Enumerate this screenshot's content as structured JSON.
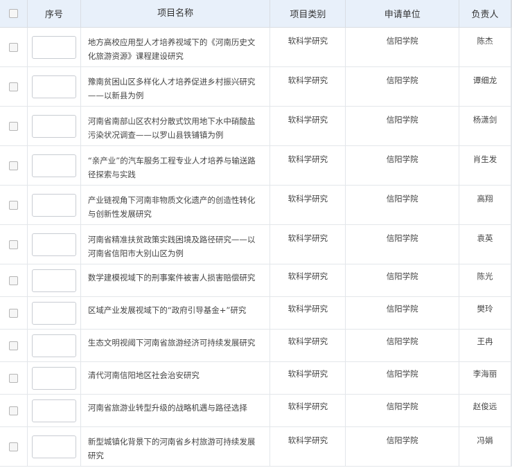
{
  "headers": {
    "seq": "序号",
    "name": "项目名称",
    "category": "项目类别",
    "unit": "申请单位",
    "leader": "负责人"
  },
  "rows": [
    {
      "name": "地方高校应用型人才培养视域下的《河南历史文化旅游资源》课程建设研究",
      "category": "软科学研究",
      "unit": "信阳学院",
      "leader": "陈杰",
      "seq_value": ""
    },
    {
      "name": "豫南贫困山区多样化人才培养促进乡村振兴研究——以新县为例",
      "category": "软科学研究",
      "unit": "信阳学院",
      "leader": "谭细龙",
      "seq_value": ""
    },
    {
      "name": "河南省南部山区农村分散式饮用地下水中硝酸盐污染状况调查——以罗山县铁铺镇为例",
      "category": "软科学研究",
      "unit": "信阳学院",
      "leader": "杨潇剑",
      "seq_value": ""
    },
    {
      "name": "“亲产业”的汽车服务工程专业人才培养与输送路径探索与实践",
      "category": "软科学研究",
      "unit": "信阳学院",
      "leader": "肖生发",
      "seq_value": ""
    },
    {
      "name": "产业链视角下河南非物质文化遗产的创造性转化与创新性发展研究",
      "category": "软科学研究",
      "unit": "信阳学院",
      "leader": "高翔",
      "seq_value": ""
    },
    {
      "name": "河南省精准扶贫政策实践困境及路径研究——以河南省信阳市大别山区为例",
      "category": "软科学研究",
      "unit": "信阳学院",
      "leader": "袁英",
      "seq_value": ""
    },
    {
      "name": "数学建模视域下的刑事案件被害人损害赔偿研究",
      "category": "软科学研究",
      "unit": "信阳学院",
      "leader": "陈光",
      "seq_value": ""
    },
    {
      "name": "区域产业发展视域下的“政府引导基金+”研究",
      "category": "软科学研究",
      "unit": "信阳学院",
      "leader": "樊玲",
      "seq_value": ""
    },
    {
      "name": "生态文明视阈下河南省旅游经济可持续发展研究",
      "category": "软科学研究",
      "unit": "信阳学院",
      "leader": "王冉",
      "seq_value": ""
    },
    {
      "name": "清代河南信阳地区社会治安研究",
      "category": "软科学研究",
      "unit": "信阳学院",
      "leader": "李海丽",
      "seq_value": ""
    },
    {
      "name": "河南省旅游业转型升级的战略机遇与路径选择",
      "category": "软科学研究",
      "unit": "信阳学院",
      "leader": "赵俊远",
      "seq_value": ""
    },
    {
      "name": "新型城镇化背景下的河南省乡村旅游可持续发展研究",
      "category": "软科学研究",
      "unit": "信阳学院",
      "leader": "冯娟",
      "seq_value": ""
    }
  ],
  "colors": {
    "header_bg": "#e8f0fa",
    "border": "#e3e6ea"
  }
}
